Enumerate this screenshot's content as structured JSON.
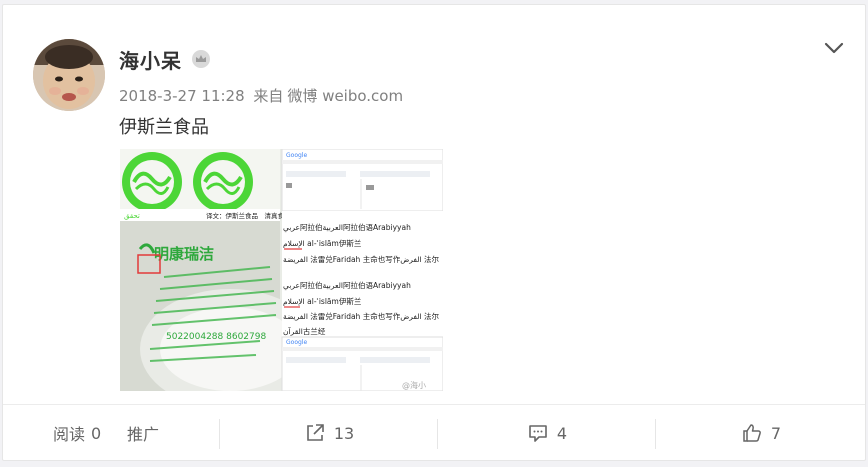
{
  "post": {
    "username": "海小呆",
    "timestamp": "2018-3-27 11:28",
    "source_prefix": "来自",
    "source": "微博 weibo.com",
    "text": "伊斯兰食品"
  },
  "image": {
    "ocr_lines": [
      "عربي阿拉伯العربية阿拉伯语Arabiyyah",
      "الإسلام al-ʾislām伊斯兰",
      "الفريضة 法雷兑Faridah 主命也写作الفرض 法尔",
      "عربي阿拉伯العربية阿拉伯语Arabiyyah",
      "الإسلام al-ʾislām伊斯兰",
      "الفريضة 法雷兑Faridah 主命也写作الفرض 法尔",
      "القرآن古兰经"
    ],
    "translate_label": "译文：伊斯兰食品　清真食品",
    "brand_text": "明康瑞洁",
    "phone": "5022004288 8602798",
    "google_label": "Google",
    "watermark": "@海小"
  },
  "footer": {
    "read_label": "阅读",
    "read_count": "0",
    "promote_label": "推广",
    "share_count": "13",
    "comment_count": "4",
    "like_count": "7"
  },
  "colors": {
    "green_seal": "#4cd637",
    "link_blue": "#1a73e8",
    "muted": "#808080"
  }
}
